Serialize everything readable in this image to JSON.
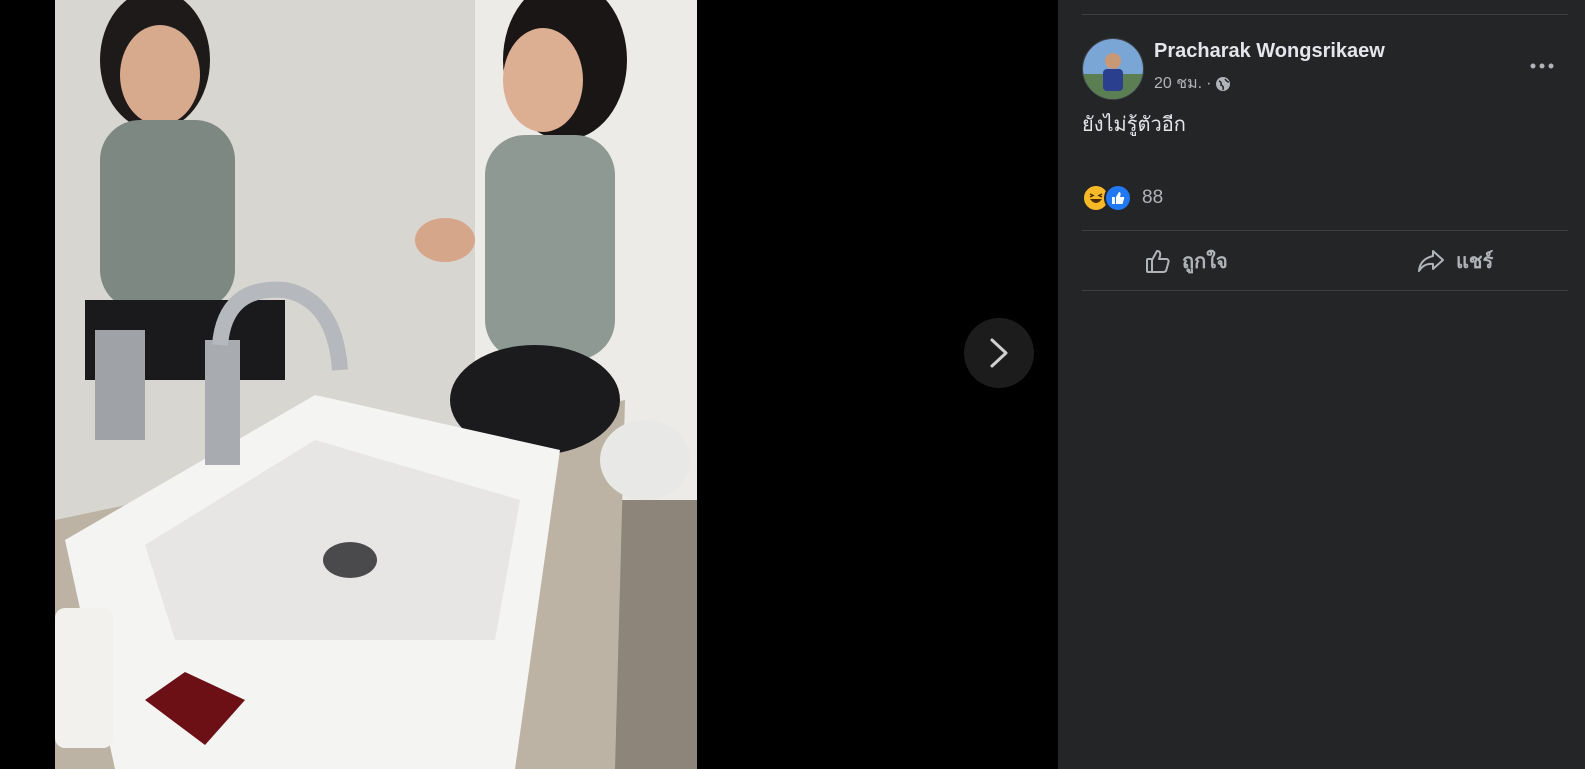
{
  "post": {
    "author": "Pracharak Wongsrikaew",
    "time": "20 ชม.",
    "separator": "·",
    "audience_icon": "globe-icon",
    "caption": "ยังไม่รู้ตัวอีก",
    "reaction_count": "88",
    "reaction_icons": [
      "haha-icon",
      "like-icon"
    ]
  },
  "actions": {
    "like_label": "ถูกใจ",
    "share_label": "แชร์"
  },
  "colors": {
    "panel_bg": "#242526",
    "text_primary": "#e4e6eb",
    "text_secondary": "#b0b3b8",
    "like_blue": "#2078f4",
    "haha_yellow": "#f7b928"
  }
}
